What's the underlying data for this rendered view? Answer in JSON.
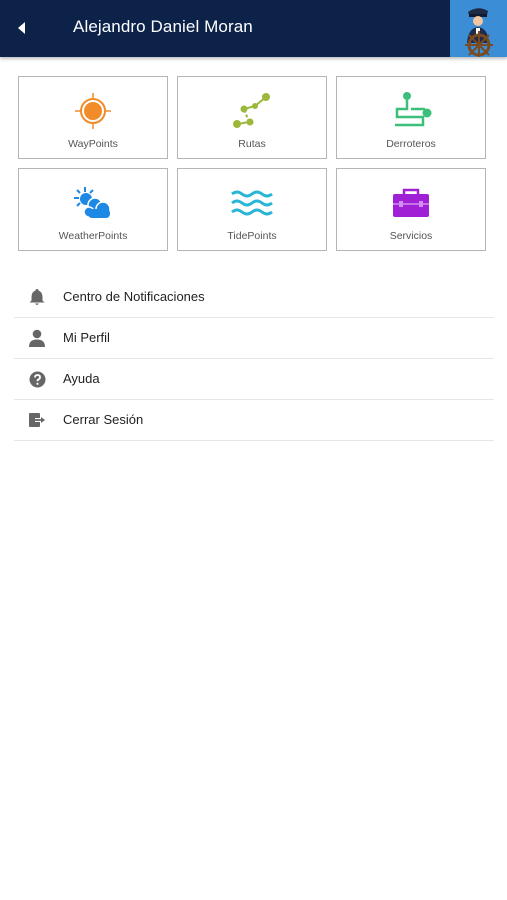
{
  "header": {
    "title": "Alejandro Daniel Moran",
    "back_icon": "back-arrow-icon",
    "avatar_icon": "captain-at-helm-avatar",
    "bar_color": "#0d2249"
  },
  "tiles": [
    {
      "label": "WayPoints",
      "icon": "crosshair-target-icon",
      "color": "#f28c28"
    },
    {
      "label": "Rutas",
      "icon": "route-points-icon",
      "color": "#9cb83a"
    },
    {
      "label": "Derroteros",
      "icon": "winding-path-icon",
      "color": "#3dbf7c"
    },
    {
      "label": "WeatherPoints",
      "icon": "sun-cloud-icon",
      "color": "#1e88e5"
    },
    {
      "label": "TidePoints",
      "icon": "waves-icon",
      "color": "#29b6d6"
    },
    {
      "label": "Servicios",
      "icon": "toolbox-icon",
      "color": "#a020d6"
    }
  ],
  "menu": [
    {
      "label": "Centro de Notificaciones",
      "icon": "bell-icon"
    },
    {
      "label": "Mi Perfil",
      "icon": "person-icon"
    },
    {
      "label": "Ayuda",
      "icon": "help-circle-icon"
    },
    {
      "label": "Cerrar Sesión",
      "icon": "logout-icon"
    }
  ]
}
